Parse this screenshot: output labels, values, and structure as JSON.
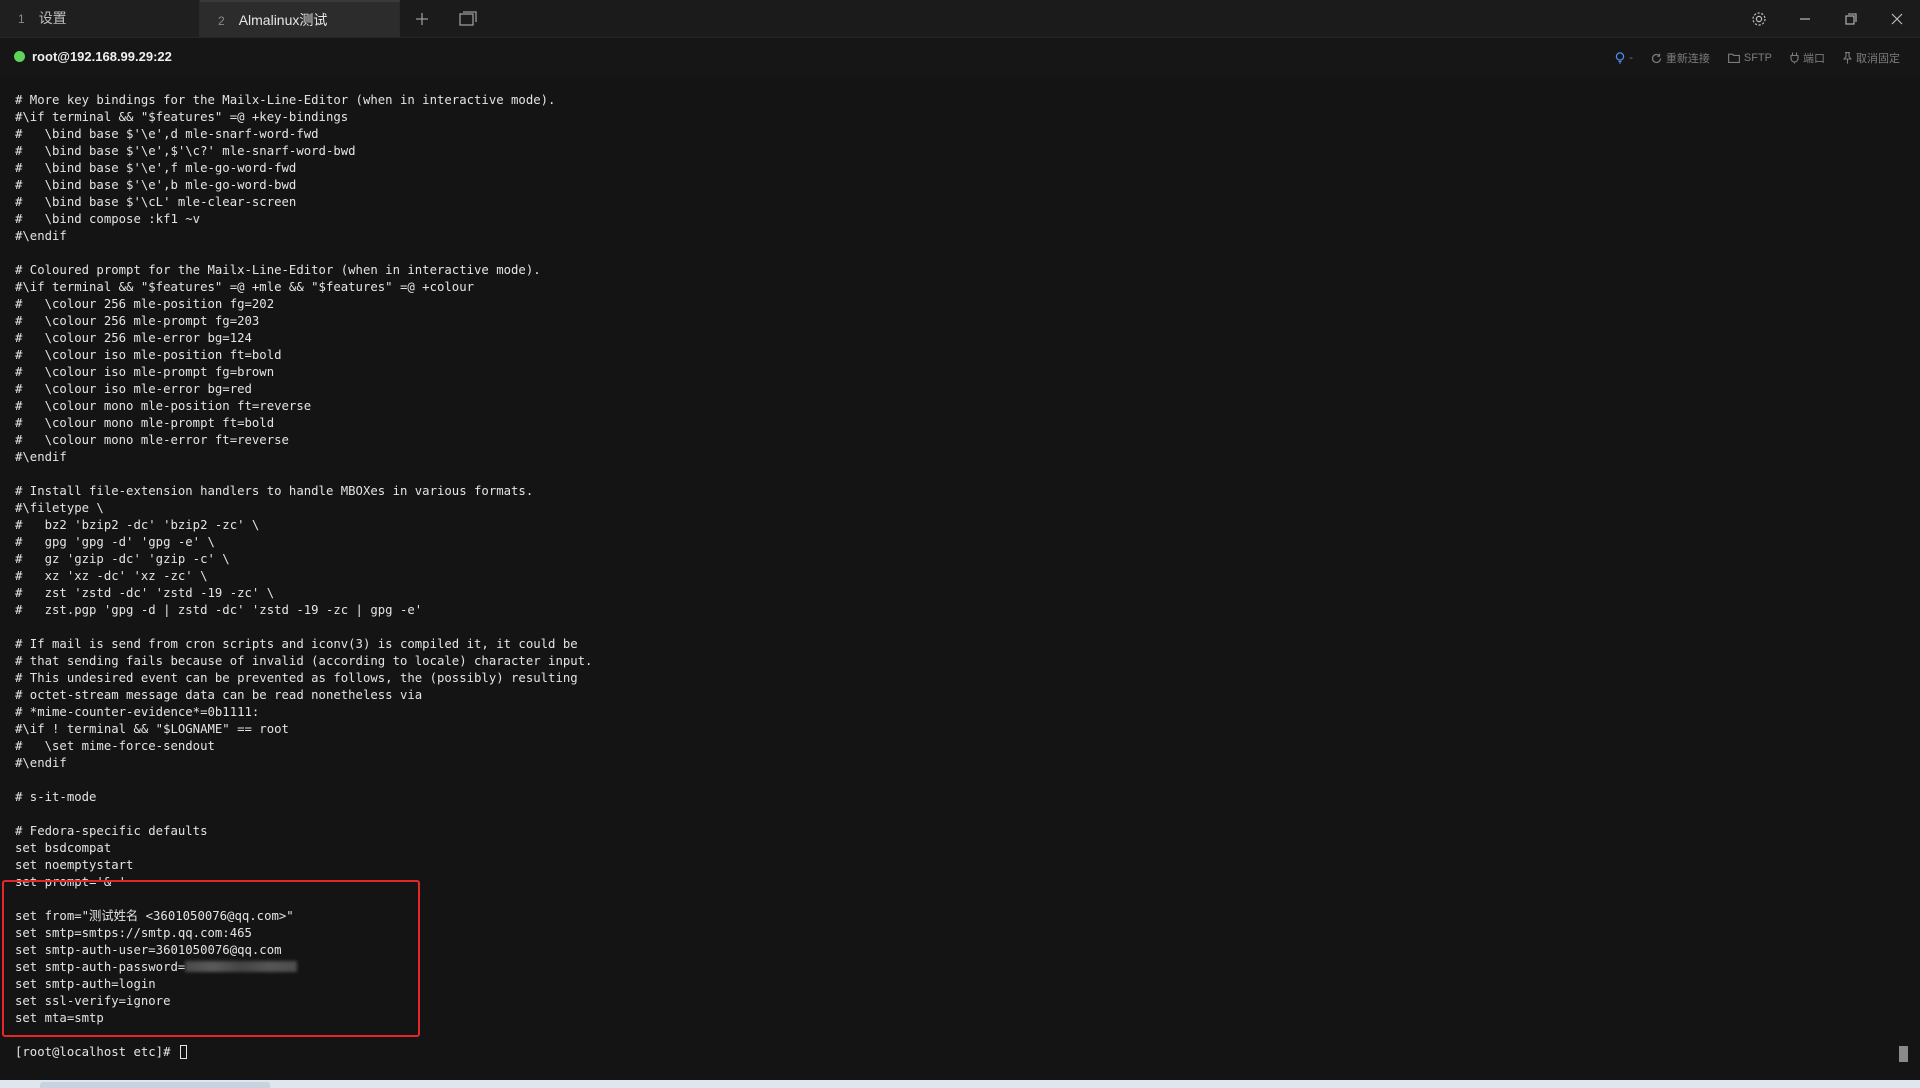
{
  "tabs": [
    {
      "num": "1",
      "label": "设置"
    },
    {
      "num": "2",
      "label": "Almalinux测试"
    }
  ],
  "status": {
    "host": "root@192.168.99.29:22",
    "actions": {
      "bulb": "-",
      "reconnect": "重新连接",
      "sftp": "SFTP",
      "port": "端口",
      "unpin": "取消固定"
    }
  },
  "terminal": {
    "lines": [
      "# More key bindings for the Mailx-Line-Editor (when in interactive mode).",
      "#\\if terminal && \"$features\" =@ +key-bindings",
      "#   \\bind base $'\\e',d mle-snarf-word-fwd",
      "#   \\bind base $'\\e',$'\\c?' mle-snarf-word-bwd",
      "#   \\bind base $'\\e',f mle-go-word-fwd",
      "#   \\bind base $'\\e',b mle-go-word-bwd",
      "#   \\bind base $'\\cL' mle-clear-screen",
      "#   \\bind compose :kf1 ~v",
      "#\\endif",
      "",
      "# Coloured prompt for the Mailx-Line-Editor (when in interactive mode).",
      "#\\if terminal && \"$features\" =@ +mle && \"$features\" =@ +colour",
      "#   \\colour 256 mle-position fg=202",
      "#   \\colour 256 mle-prompt fg=203",
      "#   \\colour 256 mle-error bg=124",
      "#   \\colour iso mle-position ft=bold",
      "#   \\colour iso mle-prompt fg=brown",
      "#   \\colour iso mle-error bg=red",
      "#   \\colour mono mle-position ft=reverse",
      "#   \\colour mono mle-prompt ft=bold",
      "#   \\colour mono mle-error ft=reverse",
      "#\\endif",
      "",
      "# Install file-extension handlers to handle MBOXes in various formats.",
      "#\\filetype \\",
      "#   bz2 'bzip2 -dc' 'bzip2 -zc' \\",
      "#   gpg 'gpg -d' 'gpg -e' \\",
      "#   gz 'gzip -dc' 'gzip -c' \\",
      "#   xz 'xz -dc' 'xz -zc' \\",
      "#   zst 'zstd -dc' 'zstd -19 -zc' \\",
      "#   zst.pgp 'gpg -d | zstd -dc' 'zstd -19 -zc | gpg -e'",
      "",
      "# If mail is send from cron scripts and iconv(3) is compiled it, it could be",
      "# that sending fails because of invalid (according to locale) character input.",
      "# This undesired event can be prevented as follows, the (possibly) resulting",
      "# octet-stream message data can be read nonetheless via",
      "# *mime-counter-evidence*=0b1111:",
      "#\\if ! terminal && \"$LOGNAME\" == root",
      "#   \\set mime-force-sendout",
      "#\\endif",
      "",
      "# s-it-mode",
      "",
      "# Fedora-specific defaults",
      "set bsdcompat",
      "set noemptystart",
      "set prompt='& '",
      "",
      "set from=\"测试姓名 <3601050076@qq.com>\"",
      "set smtp=smtps://smtp.qq.com:465",
      "set smtp-auth-user=3601050076@qq.com",
      "set smtp-auth-password=",
      "set smtp-auth=login",
      "set ssl-verify=ignore",
      "set mta=smtp",
      ""
    ],
    "prompt": "[root@localhost etc]# "
  },
  "colors": {
    "highlight": "#e3272a",
    "connected": "#5fd35a"
  }
}
